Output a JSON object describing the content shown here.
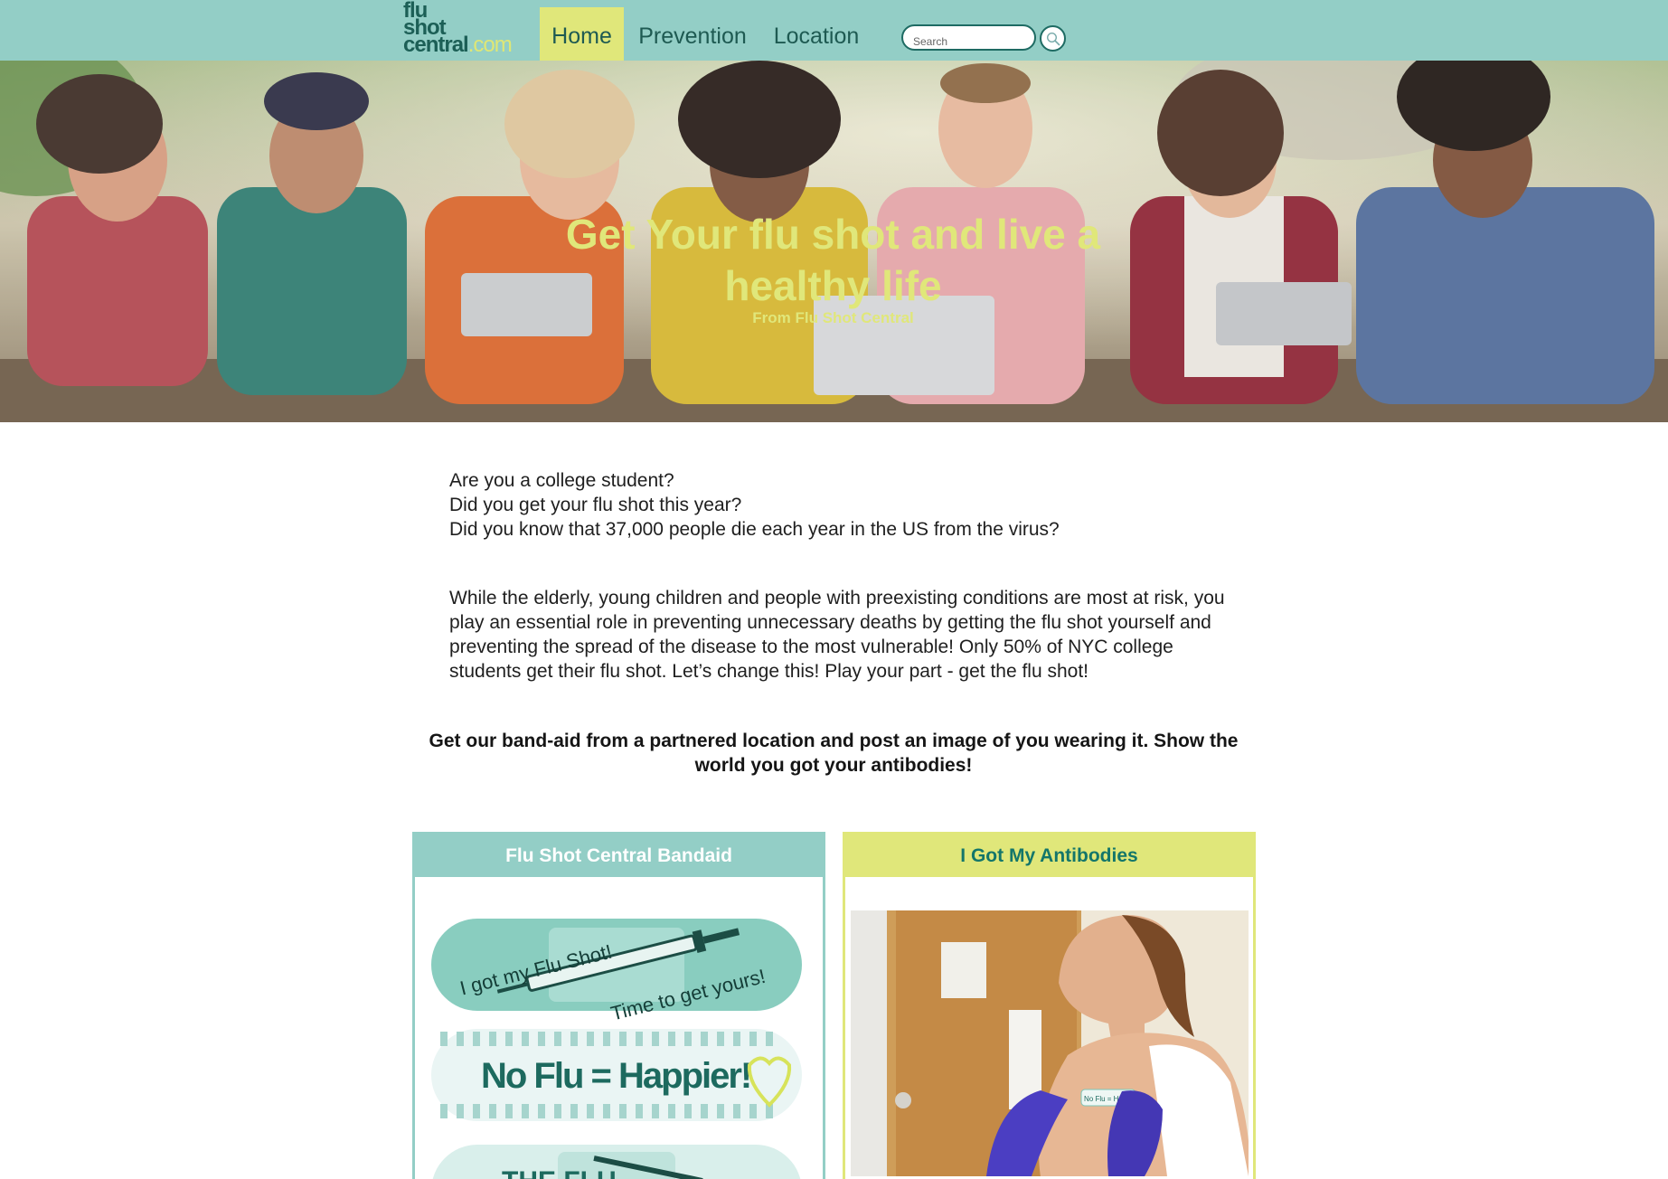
{
  "logo": {
    "line1": "flu",
    "line2": "shot",
    "line3": "central",
    "suffix": ".com"
  },
  "nav": {
    "items": [
      {
        "label": "Home",
        "active": true
      },
      {
        "label": "Prevention",
        "active": false
      },
      {
        "label": "Location",
        "active": false
      }
    ]
  },
  "search": {
    "placeholder": "Search",
    "button_icon": "search-icon"
  },
  "hero": {
    "title": "Get Your flu shot and live a healthy life",
    "subtitle": "From Flu Shot Central"
  },
  "intro": {
    "questions": [
      "Are you a college student?",
      "Did you get your flu shot this year?",
      "Did you know that 37,000 people die each year in the US from the virus?"
    ],
    "paragraph": "While the elderly, young children and people with preexisting conditions are most at risk, you play an essential role in preventing unnecessary deaths by getting the flu shot yourself and preventing the spread of the disease to the most vulnerable! Only 50% of NYC college students get their flu shot. Let’s change this! Play your part - get the flu shot!",
    "callout": "Get our band-aid from a partnered location and post an image of you wearing it. Show the world you got your antibodies!"
  },
  "cards": {
    "bandaid": {
      "title": "Flu Shot Central Bandaid",
      "bandaid1_line1": "I got my Flu Shot!",
      "bandaid1_line2": "Time to get yours!",
      "bandaid2_text": "No Flu = Happier!",
      "bandaid3_text": "THE FLU"
    },
    "antibodies": {
      "title": "I Got My Antibodies",
      "photo_sticker_text": "No Flu = Happier!"
    }
  },
  "colors": {
    "teal": "#93cec6",
    "lime": "#e0e77a",
    "dark_teal": "#1e5a52"
  }
}
